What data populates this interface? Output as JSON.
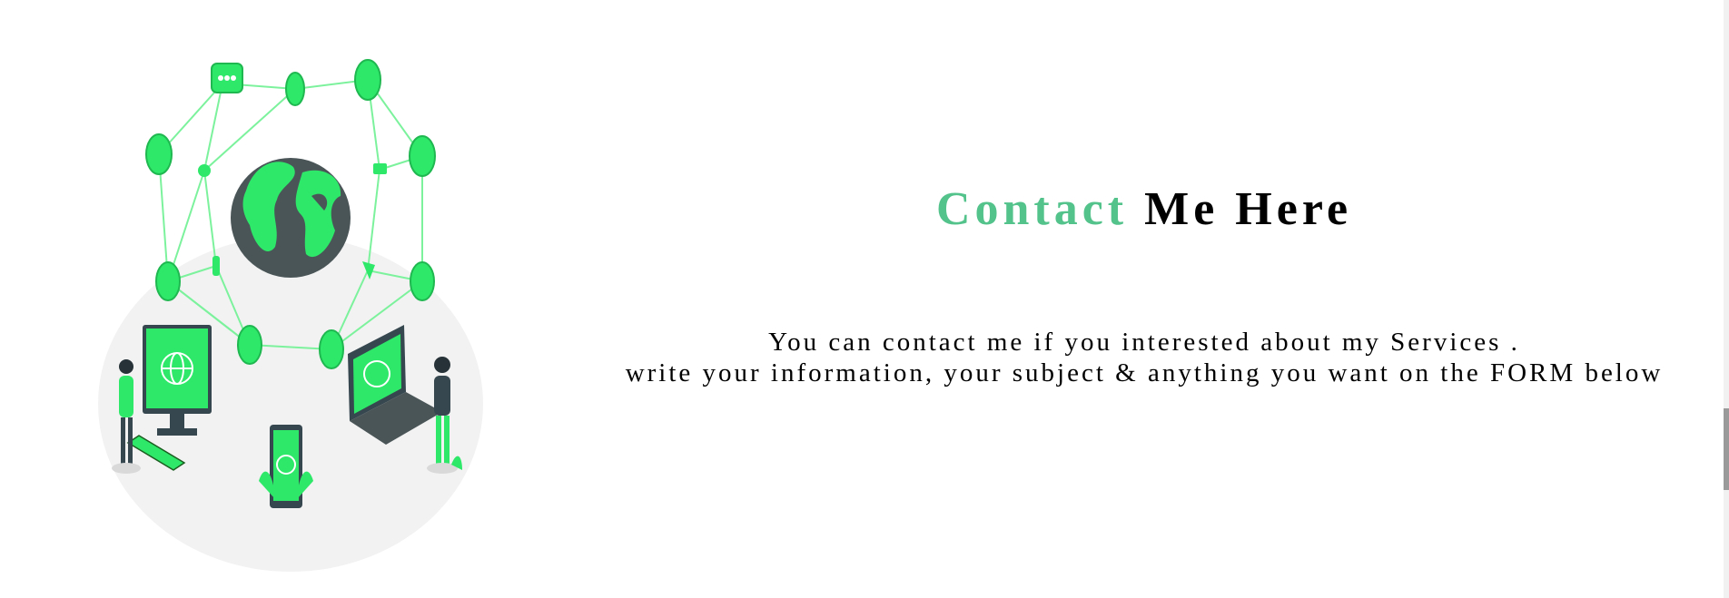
{
  "contact": {
    "heading_accent": "Contact",
    "heading_rest": "Me Here",
    "line1": "You can contact me if you interested about my Services .",
    "line2": "write your information, your subject & anything you want on the FORM below"
  },
  "illustration": {
    "icon": "connected-world-illustration-icon"
  },
  "colors": {
    "accent": "#53c28b",
    "illustration_green": "#2ee86a",
    "heading_text": "#000000",
    "planet_dark": "#4a5558"
  }
}
